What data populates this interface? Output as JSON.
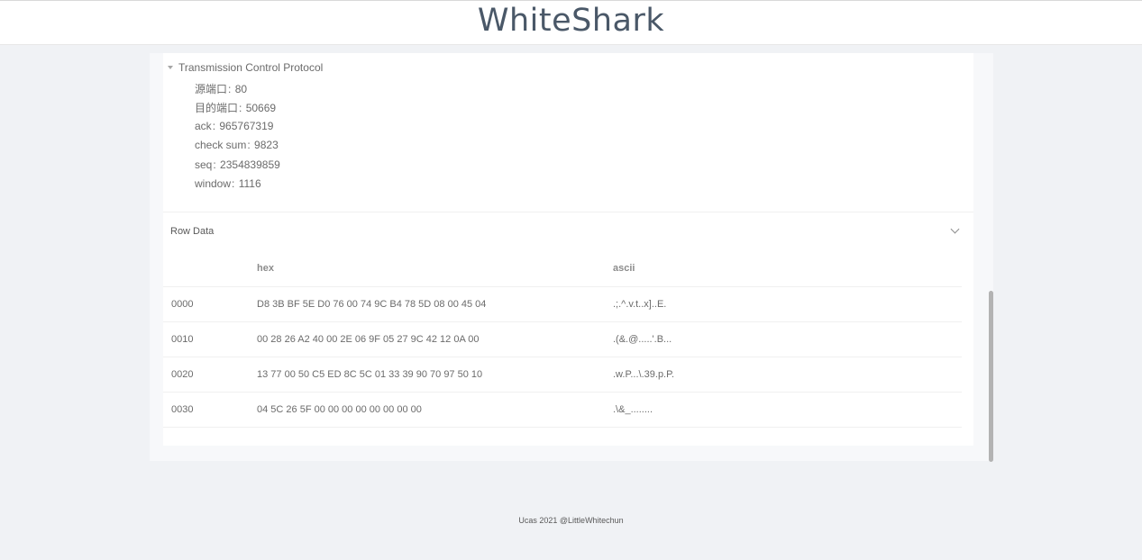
{
  "header": {
    "title": "WhiteShark"
  },
  "tcp": {
    "title": "Transmission Control Protocol",
    "fields": [
      {
        "key": "源端口",
        "value": "80"
      },
      {
        "key": "目的端口",
        "value": "50669"
      },
      {
        "key": "ack",
        "value": "965767319"
      },
      {
        "key": "check sum",
        "value": "9823"
      },
      {
        "key": "seq",
        "value": "2354839859"
      },
      {
        "key": "window",
        "value": "1116"
      }
    ]
  },
  "raw": {
    "title": "Row Data",
    "columns": [
      "",
      "hex",
      "ascii"
    ],
    "rows": [
      {
        "offset": "0000",
        "hex": "D8 3B BF 5E D0 76 00 74 9C B4 78 5D 08 00 45 04",
        "ascii": ".;.^.v.t..x]..E."
      },
      {
        "offset": "0010",
        "hex": "00 28 26 A2 40 00 2E 06 9F 05 27 9C 42 12 0A 00",
        "ascii": ".(&.@.....'.B..."
      },
      {
        "offset": "0020",
        "hex": "13 77 00 50 C5 ED 8C 5C 01 33 39 90 70 97 50 10",
        "ascii": ".w.P...\\.39.p.P."
      },
      {
        "offset": "0030",
        "hex": "04 5C 26 5F 00 00 00 00 00 00 00 00",
        "ascii": ".\\&_........"
      }
    ]
  },
  "footer": {
    "text": "Ucas 2021 @LittleWhitechun"
  }
}
